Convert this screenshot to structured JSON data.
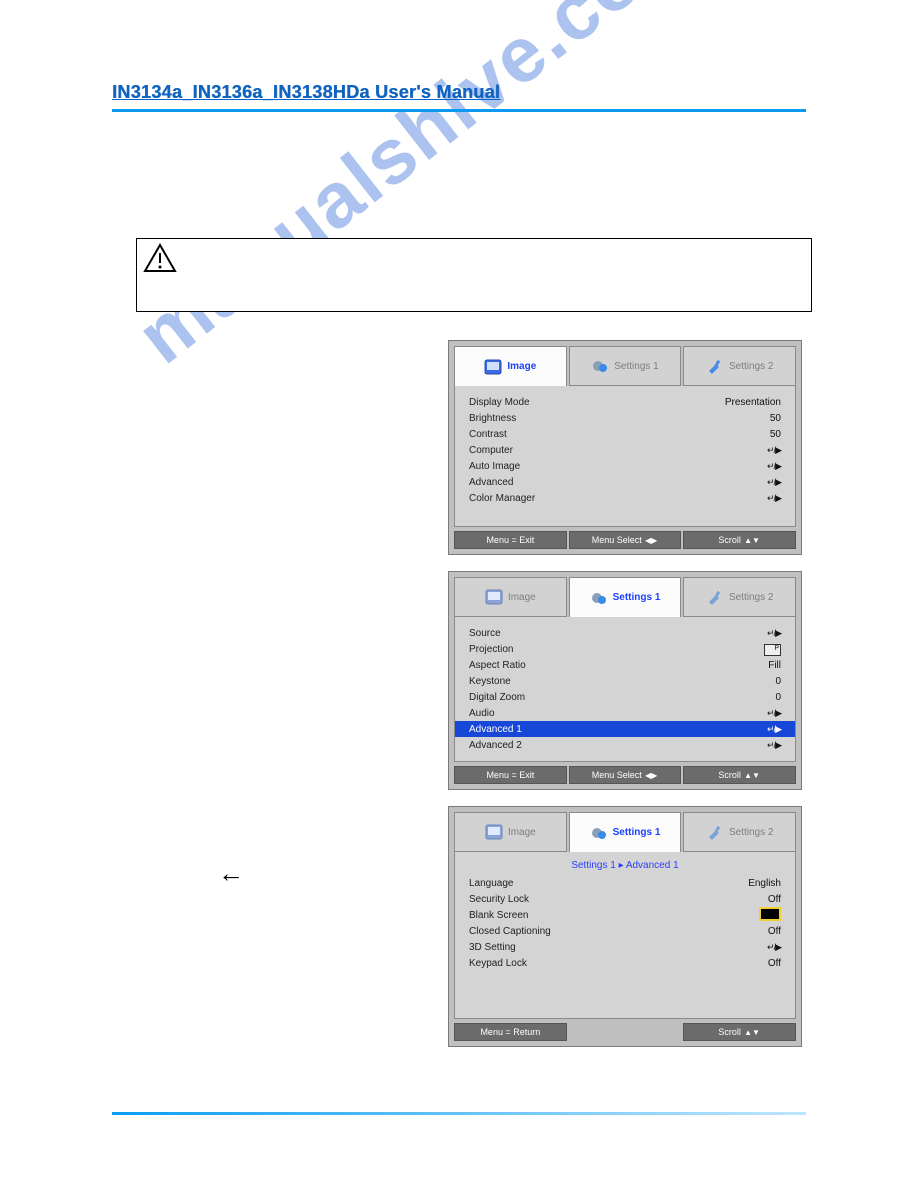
{
  "header": {
    "title": "IN3134a_IN3136a_IN3138HDa User's Manual"
  },
  "watermark": "manualshive.com",
  "tabs": {
    "image": "Image",
    "settings1": "Settings 1",
    "settings2": "Settings 2"
  },
  "footer": {
    "exit": "Menu = Exit",
    "return": "Menu = Return",
    "select": "Menu Select",
    "scroll": "Scroll"
  },
  "screen1": {
    "active_tab": "image",
    "rows": [
      {
        "label": "Display Mode",
        "value": "Presentation"
      },
      {
        "label": "Brightness",
        "value": "50"
      },
      {
        "label": "Contrast",
        "value": "50"
      },
      {
        "label": "Computer",
        "value": "↵/▶"
      },
      {
        "label": "Auto Image",
        "value": "↵/▶"
      },
      {
        "label": "Advanced",
        "value": "↵/▶"
      },
      {
        "label": "Color Manager",
        "value": "↵/▶"
      }
    ]
  },
  "screen2": {
    "active_tab": "settings1",
    "rows": [
      {
        "label": "Source",
        "value": "↵/▶"
      },
      {
        "label": "Projection",
        "value": "[P]"
      },
      {
        "label": "Aspect Ratio",
        "value": "Fill"
      },
      {
        "label": "Keystone",
        "value": "0"
      },
      {
        "label": "Digital Zoom",
        "value": "0"
      },
      {
        "label": "Audio",
        "value": "↵/▶"
      },
      {
        "label": "Advanced 1",
        "value": "↵/▶",
        "selected": true
      },
      {
        "label": "Advanced 2",
        "value": "↵/▶"
      }
    ]
  },
  "screen3": {
    "active_tab": "settings1",
    "breadcrumb": "Settings 1 ▸ Advanced 1",
    "rows": [
      {
        "label": "Language",
        "value": "English"
      },
      {
        "label": "Security Lock",
        "value": "Off"
      },
      {
        "label": "Blank Screen",
        "value": "[blank]"
      },
      {
        "label": "Closed Captioning",
        "value": "Off"
      },
      {
        "label": "3D Setting",
        "value": "↵/▶"
      },
      {
        "label": "Keypad Lock",
        "value": "Off"
      }
    ]
  }
}
